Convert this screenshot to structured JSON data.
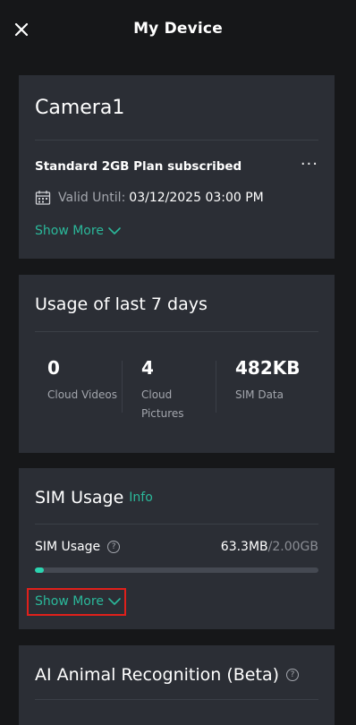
{
  "header": {
    "title": "My Device"
  },
  "device": {
    "name": "Camera1",
    "plan": "Standard 2GB Plan subscribed",
    "valid_label": "Valid Until:",
    "valid_value": "03/12/2025 03:00 PM",
    "show_more": "Show More"
  },
  "usage": {
    "title": "Usage of last 7 days",
    "stats": [
      {
        "value": "0",
        "label_lines": [
          "Cloud Videos"
        ]
      },
      {
        "value": "4",
        "label_lines": [
          "Cloud",
          "Pictures"
        ]
      },
      {
        "value": "482KB",
        "label_lines": [
          "SIM Data"
        ]
      }
    ]
  },
  "sim": {
    "title": "SIM Usage",
    "info": "Info",
    "label": "SIM Usage",
    "used": "63.3MB",
    "total": "/2.00GB",
    "progress_fraction": 0.031,
    "show_more": "Show More"
  },
  "ai": {
    "title": "AI Animal Recognition (Beta)"
  },
  "colors": {
    "accent": "#2bb89a",
    "card": "#2b2e35",
    "background": "#161719",
    "highlight": "#e0201b"
  }
}
